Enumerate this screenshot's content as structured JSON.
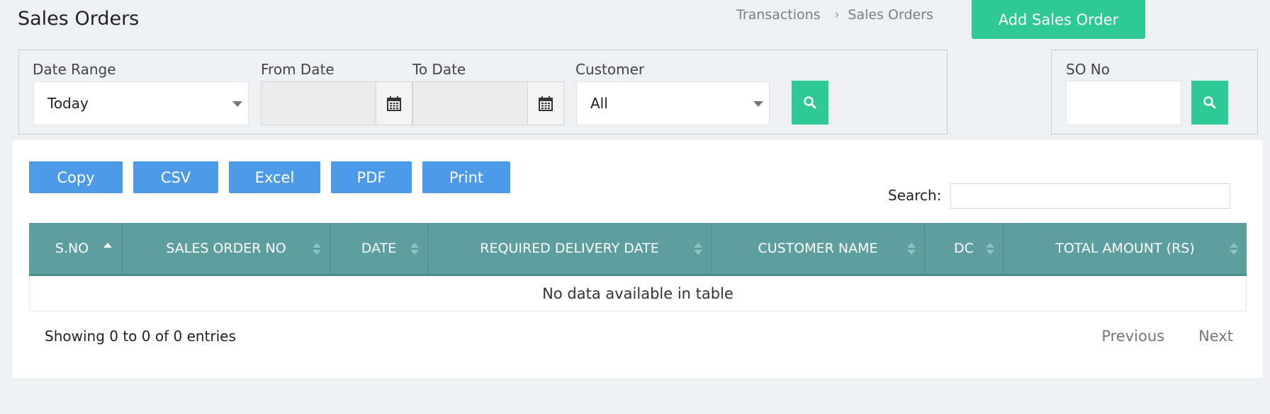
{
  "header": {
    "title": "Sales Orders",
    "breadcrumb": [
      "Transactions",
      "Sales Orders"
    ],
    "add_button": "Add Sales Order"
  },
  "filters": {
    "date_range": {
      "label": "Date Range",
      "value": "Today"
    },
    "from_date": {
      "label": "From Date",
      "value": ""
    },
    "to_date": {
      "label": "To Date",
      "value": ""
    },
    "customer": {
      "label": "Customer",
      "value": "All"
    },
    "so_no": {
      "label": "SO No",
      "value": ""
    }
  },
  "export_buttons": [
    "Copy",
    "CSV",
    "Excel",
    "PDF",
    "Print"
  ],
  "search": {
    "label": "Search:",
    "value": ""
  },
  "table": {
    "columns": [
      "S.NO",
      "SALES ORDER NO",
      "DATE",
      "REQUIRED DELIVERY DATE",
      "CUSTOMER NAME",
      "DC",
      "TOTAL AMOUNT (RS)"
    ],
    "empty_message": "No data available in table"
  },
  "footer": {
    "info": "Showing 0 to 0 of 0 entries",
    "previous": "Previous",
    "next": "Next"
  },
  "colors": {
    "primary_green": "#2ec995",
    "button_blue": "#4d9be8",
    "table_header": "#5d9f9f"
  }
}
